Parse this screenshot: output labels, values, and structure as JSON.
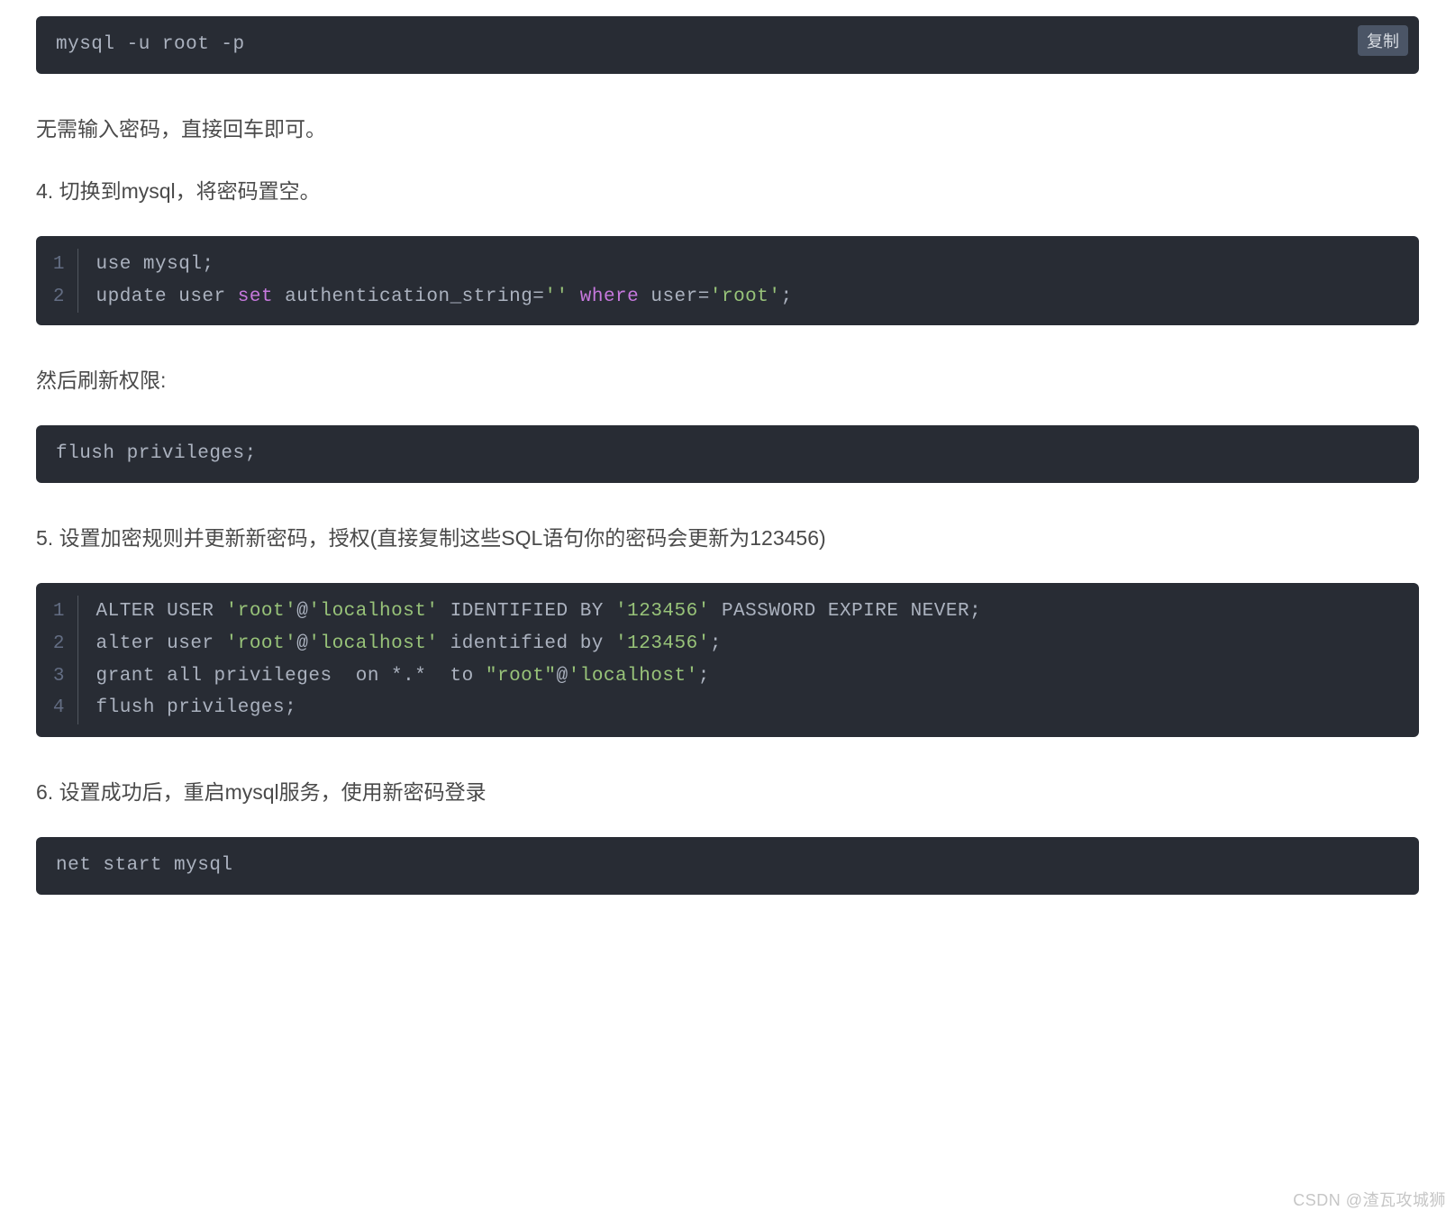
{
  "copy_label": "复制",
  "block1": {
    "line": "mysql -u root -p"
  },
  "para1": "无需输入密码，直接回车即可。",
  "para2": "4. 切换到mysql，将密码置空。",
  "block2": {
    "l1": {
      "num": "1",
      "pre": "use mysql;"
    },
    "l2": {
      "num": "2",
      "t0": "update user ",
      "kw1": "set",
      "t1": " authentication_string=",
      "s1": "''",
      "t2": " ",
      "kw2": "where",
      "t3": " user=",
      "s2": "'root'",
      "t4": ";"
    }
  },
  "para3": "然后刷新权限:",
  "block3": {
    "line": "flush privileges;"
  },
  "para4": "5. 设置加密规则并更新新密码，授权(直接复制这些SQL语句你的密码会更新为123456)",
  "block4": {
    "l1": {
      "num": "1",
      "t0": "ALTER USER ",
      "s1": "'root'",
      "t1": "@",
      "s2": "'localhost'",
      "t2": " IDENTIFIED BY ",
      "s3": "'123456'",
      "t3": " PASSWORD EXPIRE NEVER;"
    },
    "l2": {
      "num": "2",
      "t0": "alter user ",
      "s1": "'root'",
      "t1": "@",
      "s2": "'localhost'",
      "t2": " identified by ",
      "s3": "'123456'",
      "t3": ";"
    },
    "l3": {
      "num": "3",
      "t0": "grant all privileges  on *.*  to ",
      "s1": "\"root\"",
      "t1": "@",
      "s2": "'localhost'",
      "t2": ";"
    },
    "l4": {
      "num": "4",
      "pre": "flush privileges;"
    }
  },
  "para5": "6. 设置成功后，重启mysql服务，使用新密码登录",
  "block5": {
    "line": "net start mysql"
  },
  "watermark": "CSDN @渣瓦攻城狮"
}
